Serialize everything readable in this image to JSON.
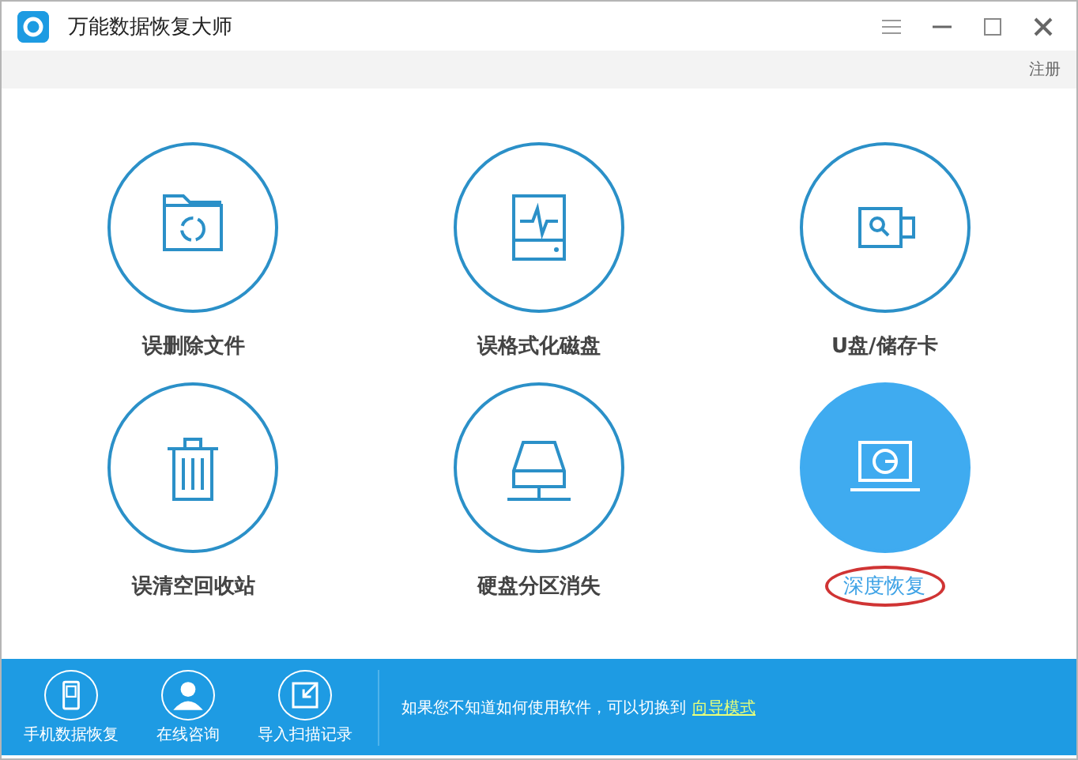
{
  "window": {
    "title": "万能数据恢复大师"
  },
  "toolbar": {
    "register": "注册"
  },
  "modes": [
    {
      "kind": "folder",
      "label": "误删除文件",
      "selected": false,
      "circled": false
    },
    {
      "kind": "disk",
      "label": "误格式化磁盘",
      "selected": false,
      "circled": false
    },
    {
      "kind": "usb",
      "label": "U盘/储存卡",
      "selected": false,
      "circled": false
    },
    {
      "kind": "trash",
      "label": "误清空回收站",
      "selected": false,
      "circled": false
    },
    {
      "kind": "server",
      "label": "硬盘分区消失",
      "selected": false,
      "circled": false
    },
    {
      "kind": "laptop",
      "label": "深度恢复",
      "selected": true,
      "circled": true
    }
  ],
  "footer": {
    "actions": [
      {
        "kind": "phone",
        "label": "手机数据恢复"
      },
      {
        "kind": "person",
        "label": "在线咨询"
      },
      {
        "kind": "import",
        "label": "导入扫描记录"
      }
    ],
    "hint": "如果您不知道如何使用软件，可以切换到",
    "link": "向导模式"
  }
}
